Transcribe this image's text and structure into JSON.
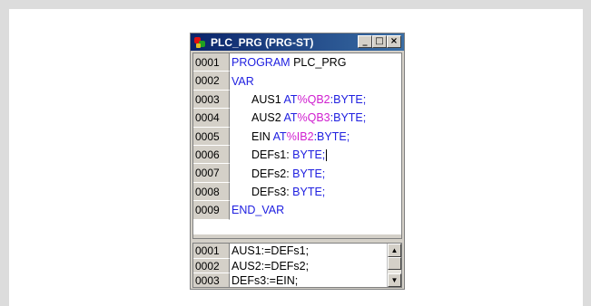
{
  "window": {
    "title": "PLC_PRG (PRG-ST)",
    "buttons": {
      "minimize": "_",
      "maximize": "□",
      "close": "×"
    }
  },
  "declarations": [
    {
      "num": "0001",
      "code": [
        "PROGRAM",
        " PLC_PRG"
      ]
    },
    {
      "num": "0002",
      "code": [
        "VAR"
      ]
    },
    {
      "num": "0003",
      "code": [
        "AUS1",
        " AT",
        "%QB2",
        ":BYTE;"
      ]
    },
    {
      "num": "0004",
      "code": [
        "AUS2",
        " AT",
        "%QB3",
        ":BYTE;"
      ]
    },
    {
      "num": "0005",
      "code": [
        "EIN",
        " AT",
        "%IB2",
        ":BYTE;"
      ]
    },
    {
      "num": "0006",
      "code": [
        "DEFs1: ",
        "BYTE;"
      ]
    },
    {
      "num": "0007",
      "code": [
        "DEFs2: ",
        "BYTE;"
      ]
    },
    {
      "num": "0008",
      "code": [
        "DEFs3: ",
        "BYTE;"
      ]
    },
    {
      "num": "0009",
      "code": [
        "END_VAR"
      ]
    }
  ],
  "body": [
    {
      "num": "0001",
      "code": "AUS1:=DEFs1;"
    },
    {
      "num": "0002",
      "code": "AUS2:=DEFs2;"
    },
    {
      "num": "0003",
      "code": "DEFs3:=EIN;"
    }
  ],
  "colors": {
    "keyword": "#2020e0",
    "address": "#d020d0",
    "titlebar": "#0a246a"
  },
  "icons": {
    "app": "plc-program-icon",
    "scroll_up": "▲",
    "scroll_down": "▼"
  }
}
